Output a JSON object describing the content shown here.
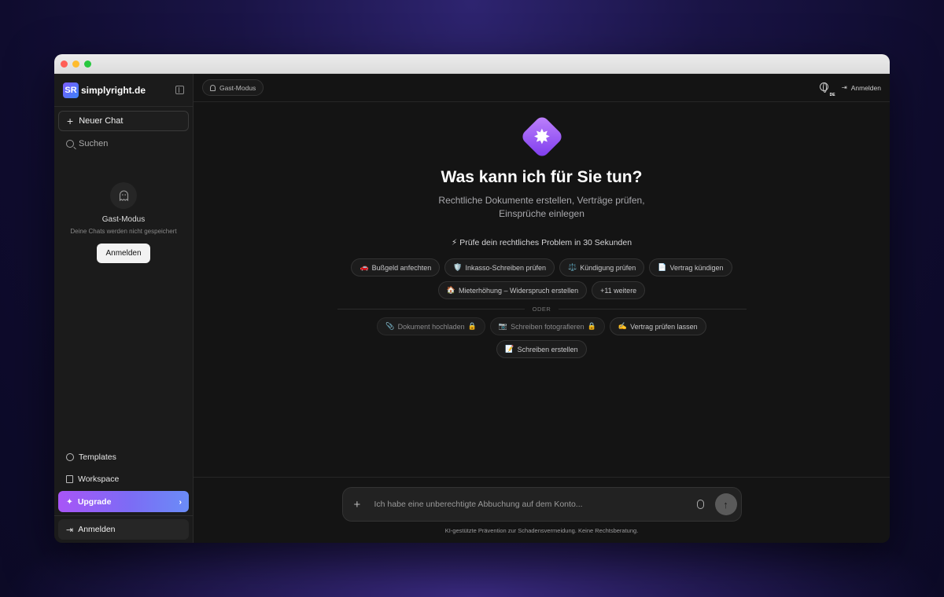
{
  "sidebar": {
    "logo_badge": "SR",
    "logo_text": "simplyright.de",
    "new_chat": "Neuer Chat",
    "search": "Suchen",
    "guest": {
      "title": "Gast-Modus",
      "subtitle": "Deine Chats werden nicht gespeichert",
      "button": "Anmelden"
    },
    "templates": "Templates",
    "workspace": "Workspace",
    "upgrade": "Upgrade",
    "login": "Anmelden"
  },
  "topbar": {
    "guest_pill": "Gast-Modus",
    "language": "DE",
    "login": "Anmelden"
  },
  "hero": {
    "title": "Was kann ich für Sie tun?",
    "subtitle": "Rechtliche Dokumente erstellen, Verträge prüfen, Einsprüche einlegen",
    "hint": "⚡ Prüfe dein rechtliches Problem in 30 Sekunden"
  },
  "chips": [
    {
      "icon": "🚗",
      "label": "Bußgeld anfechten"
    },
    {
      "icon": "🛡️",
      "label": "Inkasso-Schreiben prüfen"
    },
    {
      "icon": "⚖️",
      "label": "Kündigung prüfen"
    },
    {
      "icon": "📄",
      "label": "Vertrag kündigen"
    },
    {
      "icon": "🏠",
      "label": "Mieterhöhung – Widerspruch erstellen"
    },
    {
      "icon": "",
      "label": "+11 weitere"
    }
  ],
  "or_label": "ODER",
  "actions": [
    {
      "icon": "📎",
      "label": "Dokument hochladen",
      "lock": "🔒"
    },
    {
      "icon": "📷",
      "label": "Schreiben fotografieren",
      "lock": "🔒"
    },
    {
      "icon": "✍️",
      "label": "Vertrag prüfen lassen",
      "lock": ""
    },
    {
      "icon": "📝",
      "label": "Schreiben erstellen",
      "lock": ""
    }
  ],
  "composer": {
    "value": "Ich habe eine unberechtigte Abbuchung auf dem Konto...",
    "disclaimer": "KI-gestützte Prävention zur Schadensvermeidung. Keine Rechtsberatung."
  }
}
